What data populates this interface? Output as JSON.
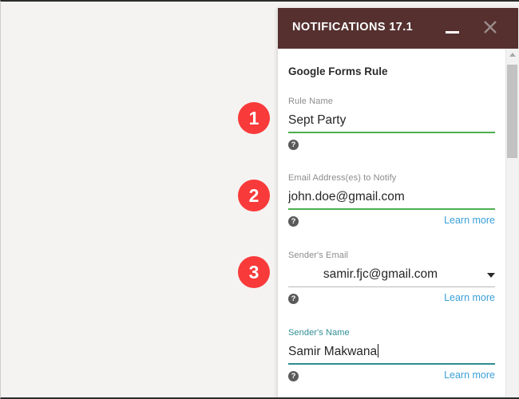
{
  "window": {
    "title": "NOTIFICATIONS 17.1",
    "minimize_icon": "minimize-icon",
    "close_icon": "close-icon",
    "header_color": "#55302f"
  },
  "panel": {
    "section_title": "Google Forms Rule",
    "help_glyph": "?",
    "fields": [
      {
        "label": "Rule Name",
        "value": "Sept Party",
        "type": "text",
        "underline_color": "#4caf50",
        "focused": false,
        "has_learn_more": false,
        "learn_more": ""
      },
      {
        "label": "Email Address(es) to Notify",
        "value": "john.doe@gmail.com",
        "type": "text",
        "underline_color": "#4caf50",
        "focused": false,
        "has_learn_more": true,
        "learn_more": "Learn more"
      },
      {
        "label": "Sender's Email",
        "value": "samir.fjc@gmail.com",
        "type": "select",
        "underline_color": "#b9b9b9",
        "focused": false,
        "has_learn_more": true,
        "learn_more": "Learn more"
      },
      {
        "label": "Sender's Name",
        "value": "Samir Makwana",
        "type": "text",
        "underline_color": "#2f8e93",
        "focused": true,
        "has_learn_more": true,
        "learn_more": "Learn more"
      }
    ]
  },
  "annotations": {
    "badge_color": "#f93a3a",
    "steps": [
      {
        "number": "1"
      },
      {
        "number": "2"
      },
      {
        "number": "3"
      }
    ]
  },
  "scrollbar": {
    "up_arrow_icon": "scroll-up-arrow-icon"
  }
}
